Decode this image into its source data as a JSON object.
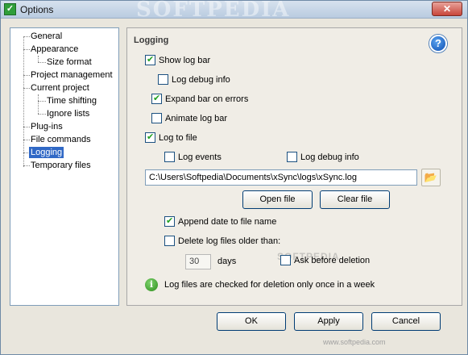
{
  "window": {
    "title": "Options",
    "watermark": "SOFTPEDIA",
    "close_glyph": "✕",
    "app_icon": "checkmark-icon"
  },
  "tree": {
    "items": [
      {
        "label": "General",
        "selected": false
      },
      {
        "label": "Appearance",
        "selected": false
      },
      {
        "label": "Size format",
        "selected": false
      },
      {
        "label": "Project management",
        "selected": false
      },
      {
        "label": "Current project",
        "selected": false
      },
      {
        "label": "Time shifting",
        "selected": false
      },
      {
        "label": "Ignore lists",
        "selected": false
      },
      {
        "label": "Plug-ins",
        "selected": false
      },
      {
        "label": "File commands",
        "selected": false
      },
      {
        "label": "Logging",
        "selected": true
      },
      {
        "label": "Temporary files",
        "selected": false
      }
    ]
  },
  "panel": {
    "title": "Logging",
    "help_icon": "help-icon",
    "show_log_bar": {
      "label": "Show log bar",
      "checked": true
    },
    "log_debug_info_bar": {
      "label": "Log debug info",
      "checked": false
    },
    "expand_bar_on_errors": {
      "label": "Expand bar on errors",
      "checked": true
    },
    "animate_log_bar": {
      "label": "Animate log bar",
      "checked": false
    },
    "log_to_file": {
      "label": "Log to file",
      "checked": true
    },
    "log_events": {
      "label": "Log events",
      "checked": false
    },
    "log_debug_info_file": {
      "label": "Log debug info",
      "checked": false
    },
    "log_path": "C:\\Users\\Softpedia\\Documents\\xSync\\logs\\xSync.log",
    "open_file_label": "Open file",
    "clear_file_label": "Clear file",
    "append_date": {
      "label": "Append date to file name",
      "checked": true
    },
    "delete_older": {
      "label": "Delete log files older than:",
      "checked": false
    },
    "days_value": "30",
    "days_label": "days",
    "ask_before_deletion": {
      "label": "Ask before deletion",
      "checked": false
    },
    "ghost_watermark": "SOFTPEDIA",
    "info_icon": "info-icon",
    "info_text": "Log files are checked for deletion only once in a week"
  },
  "footer": {
    "ok_label": "OK",
    "apply_label": "Apply",
    "cancel_label": "Cancel",
    "watermark": "www.softpedia.com"
  }
}
